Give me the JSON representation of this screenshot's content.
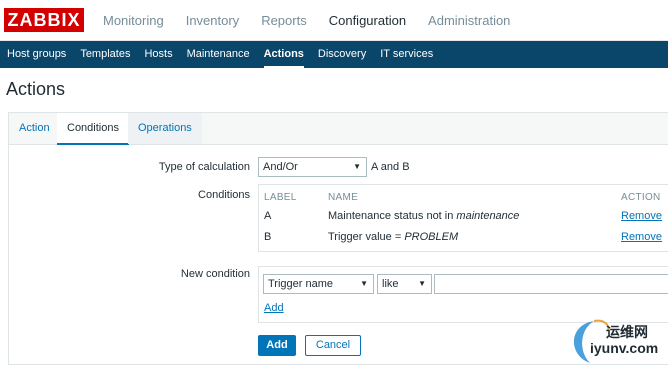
{
  "brand": {
    "logo": "ZABBIX"
  },
  "topmenu": [
    "Monitoring",
    "Inventory",
    "Reports",
    "Configuration",
    "Administration"
  ],
  "subnav": [
    "Host groups",
    "Templates",
    "Hosts",
    "Maintenance",
    "Actions",
    "Discovery",
    "IT services"
  ],
  "page": {
    "title": "Actions"
  },
  "tabs": [
    "Action",
    "Conditions",
    "Operations"
  ],
  "form": {
    "calc_label": "Type of calculation",
    "calc_value": "And/Or",
    "calc_formula": "A and B",
    "conditions_label": "Conditions",
    "headers": {
      "label": "LABEL",
      "name": "NAME",
      "action": "ACTION"
    },
    "conditions": [
      {
        "label": "A",
        "name_prefix": "Maintenance status not in ",
        "name_italic": "maintenance",
        "action": "Remove"
      },
      {
        "label": "B",
        "name_prefix": "Trigger value = ",
        "name_italic": "PROBLEM",
        "action": "Remove"
      }
    ],
    "new_condition_label": "New condition",
    "new_condition_type": "Trigger name",
    "new_condition_operator": "like",
    "new_condition_value": "",
    "add_link": "Add",
    "add_button": "Add",
    "cancel_button": "Cancel"
  },
  "watermark": {
    "text": "运维网",
    "url": "iyunv.com"
  },
  "colors": {
    "brand_red": "#d40000",
    "subnav_bg": "#0a466a",
    "link_blue": "#0275b8"
  }
}
